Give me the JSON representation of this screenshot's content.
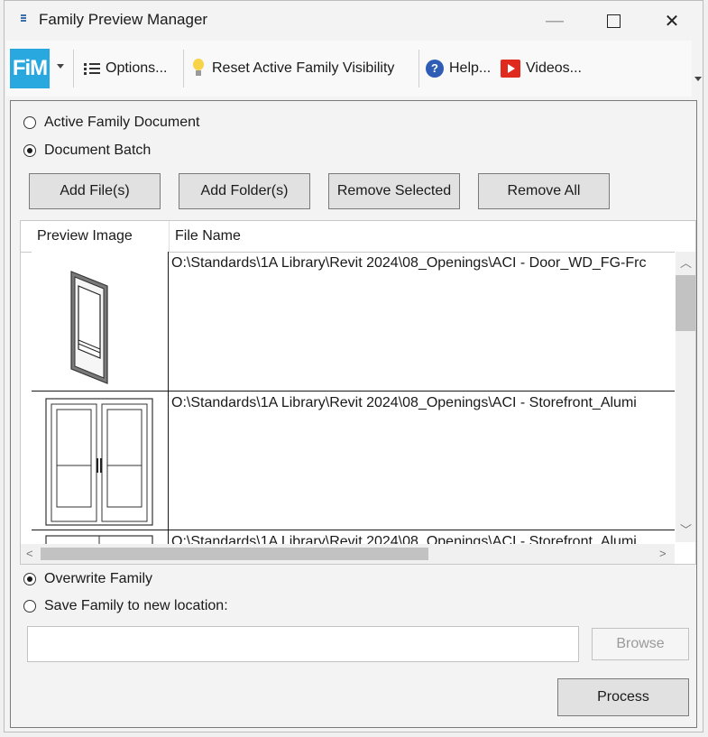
{
  "window": {
    "title": "Family Preview Manager",
    "minimize_glyph": "—",
    "close_glyph": "✕"
  },
  "toolbar": {
    "logo_text": "FiM",
    "options_label": "Options...",
    "reset_label": "Reset Active Family Visibility",
    "help_label": "Help...",
    "videos_label": "Videos..."
  },
  "source": {
    "options": [
      {
        "label": "Active Family Document",
        "checked": false
      },
      {
        "label": "Document Batch",
        "checked": true
      }
    ]
  },
  "buttons": {
    "add_files": "Add File(s)",
    "add_folder": "Add Folder(s)",
    "remove_selected": "Remove Selected",
    "remove_all": "Remove All",
    "browse": "Browse",
    "process": "Process"
  },
  "grid": {
    "columns": [
      "Preview Image",
      "File Name"
    ],
    "rows": [
      {
        "file": "O:\\Standards\\1A Library\\Revit 2024\\08_Openings\\ACI - Door_WD_FG-Frc",
        "preview": "single-door"
      },
      {
        "file": "O:\\Standards\\1A Library\\Revit 2024\\08_Openings\\ACI - Storefront_Alumi",
        "preview": "double-door"
      },
      {
        "file": "O:\\Standards\\1A Library\\Revit 2024\\08_Openings\\ACI - Storefront_Alumi",
        "preview": "storefront-partial"
      }
    ]
  },
  "save": {
    "options": [
      {
        "label": "Overwrite Family",
        "checked": true
      },
      {
        "label": "Save Family to new location:",
        "checked": false
      }
    ],
    "path_value": ""
  },
  "colors": {
    "logo_bg": "#29a8e0",
    "help_icon": "#2f5db5",
    "video_icon": "#e02a1e",
    "bulb": "#f7d34a"
  }
}
